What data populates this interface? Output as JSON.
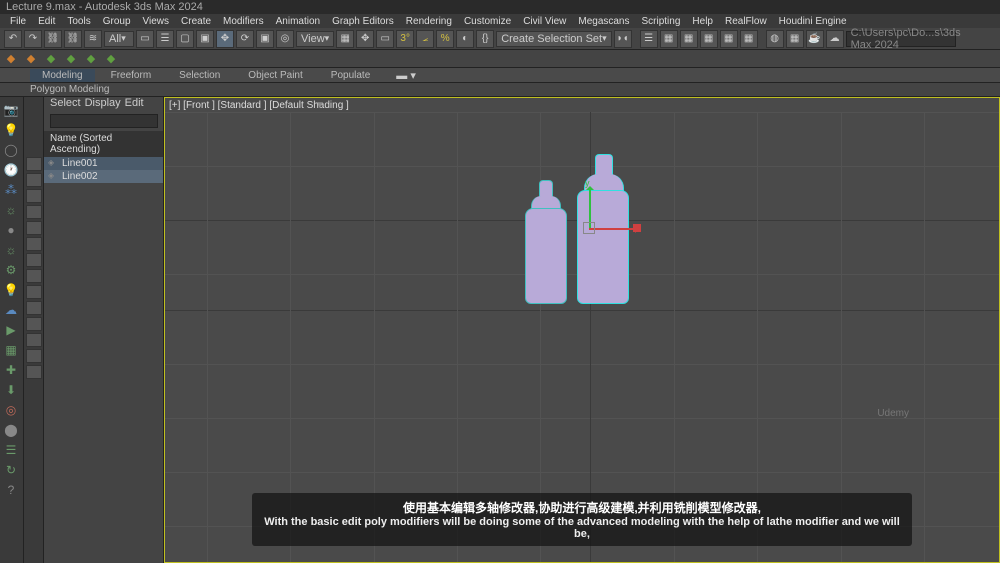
{
  "title": "Lecture 9.max - Autodesk 3ds Max 2024",
  "menu": [
    "File",
    "Edit",
    "Tools",
    "Group",
    "Views",
    "Create",
    "Modifiers",
    "Animation",
    "Graph Editors",
    "Rendering",
    "Customize",
    "Civil View",
    "Megascans",
    "Scripting",
    "Help",
    "RealFlow",
    "Houdini Engine"
  ],
  "toolbar": {
    "dropdown1": "All",
    "dropdown2": "View",
    "selection_set": "Create Selection Set",
    "path_input": "C:\\Users\\pc\\Do...s\\3ds Max 2024"
  },
  "ribbon": {
    "tabs": [
      "Modeling",
      "Freeform",
      "Selection",
      "Object Paint",
      "Populate"
    ],
    "panel": "Polygon Modeling"
  },
  "outliner": {
    "tools": [
      "Select",
      "Display",
      "Edit"
    ],
    "header": "Name (Sorted Ascending)",
    "items": [
      "Line001",
      "Line002"
    ]
  },
  "viewport": {
    "label": "[+] [Front ] [Standard ] [Default Shading ]",
    "watermark": "Udemy"
  },
  "subtitle": {
    "line1": "使用基本编辑多轴修改器,协助进行高级建模,并利用铣削模型修改器,",
    "line2": "With the basic edit poly modifiers will be doing some of the advanced modeling with the help of lathe modifier and we will be,"
  }
}
